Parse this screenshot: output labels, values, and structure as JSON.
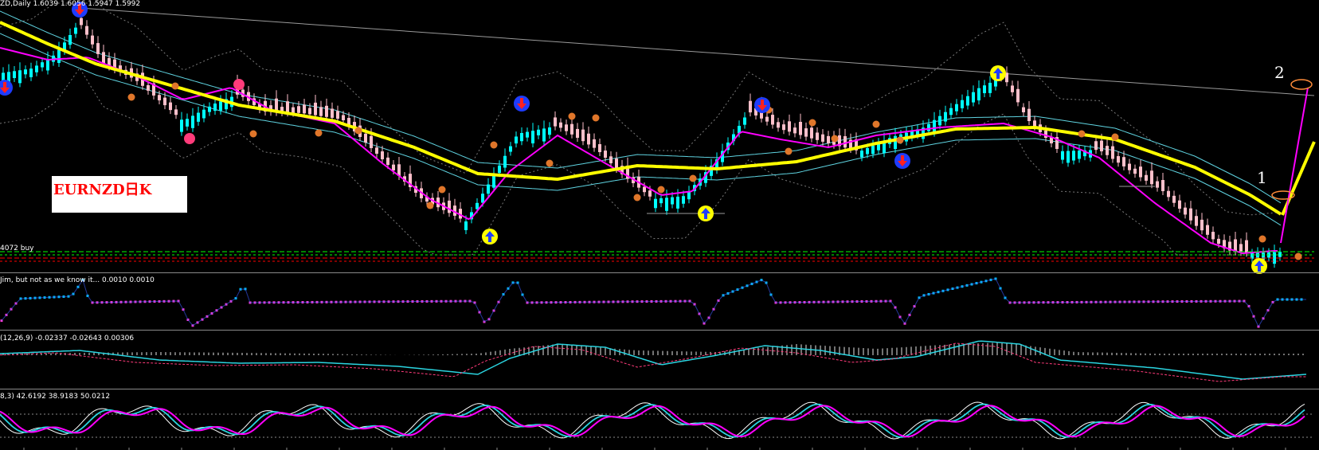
{
  "main_panel": {
    "header": "ZD,Daily  1.6039 1.6056 1.5947 1.5992",
    "order_label": "4072 buy",
    "overlay_label": "EURNZD日K",
    "annotations": [
      "1",
      "2"
    ]
  },
  "indicator_panels": [
    {
      "header": "Jim, but not as we know it...  0.0010 0.0010"
    },
    {
      "header": "(12,26,9) -0.02337 -0.02643 0.00306"
    },
    {
      "header": "8,3) 42.6192 38.9183 50.0212"
    }
  ],
  "colors": {
    "background": "#000000",
    "bull_candle": "#00ffff",
    "bear_candle": "#ffc0cb",
    "fast_ma": "#ff00ff",
    "slow_ma": "#ffff00",
    "envelope": "#5fd3e0",
    "bollinger": "#7a7a7a",
    "trendline": "#9a9a9a",
    "buy_line": "#00ff00",
    "sell_line": "#ff0000",
    "fractal_marker": "#e0762a",
    "buy_arrow": "#ffff00",
    "sell_arrow": "#1e3cff",
    "annotation_ellipse": "#ff8c3a"
  },
  "icons": [
    "up-arrow-signal-icon",
    "down-arrow-signal-icon",
    "fractal-dot-icon"
  ]
}
